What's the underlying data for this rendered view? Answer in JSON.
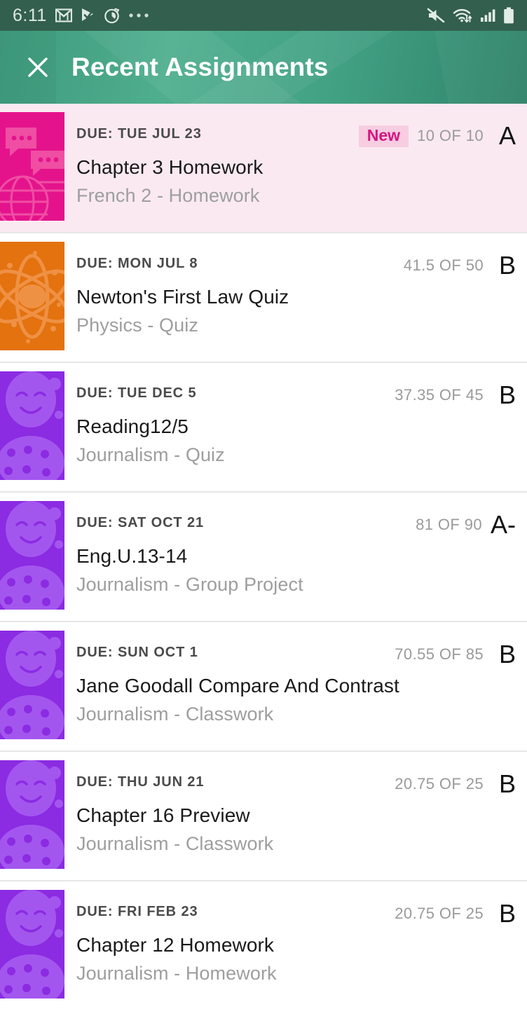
{
  "status_bar": {
    "time": "6:11",
    "left_icons": [
      "gmail-icon",
      "play-check-icon",
      "alarm-sync-icon",
      "overflow-dots-icon"
    ],
    "right_icons": [
      "volume-muted-icon",
      "wifi-icon",
      "cellular-signal-icon",
      "battery-icon"
    ],
    "background": "#335f4e"
  },
  "app_bar": {
    "title": "Recent Assignments",
    "close_label": "×",
    "background_start": "#4fae8e",
    "background_end": "#2f8369"
  },
  "assignments": [
    {
      "due": "DUE: TUE JUL 23",
      "title": "Chapter 3 Homework",
      "meta": "French 2 - Homework",
      "badge": "New",
      "score": "10 OF 10",
      "grade": "A",
      "highlight": true,
      "thumb_kind": "speech-globe",
      "thumb_color": "#e4138c",
      "thumb_accent": "#ef53a7"
    },
    {
      "due": "DUE: MON JUL 8",
      "title": "Newton's First Law Quiz",
      "meta": "Physics - Quiz",
      "badge": "",
      "score": "41.5 OF 50",
      "grade": "B",
      "highlight": false,
      "thumb_kind": "atom",
      "thumb_color": "#e3720f",
      "thumb_accent": "#ef914a"
    },
    {
      "due": "DUE: TUE DEC 5",
      "title": "Reading12/5",
      "meta": "Journalism - Quiz",
      "badge": "",
      "score": "37.35 OF 45",
      "grade": "B",
      "highlight": false,
      "thumb_kind": "masks",
      "thumb_color": "#8b2be2",
      "thumb_accent": "#a356ee"
    },
    {
      "due": "DUE: SAT OCT 21",
      "title": "Eng.U.13-14",
      "meta": "Journalism - Group Project",
      "badge": "",
      "score": "81 OF 90",
      "grade": "A-",
      "highlight": false,
      "thumb_kind": "masks",
      "thumb_color": "#8b2be2",
      "thumb_accent": "#a356ee"
    },
    {
      "due": "DUE: SUN OCT 1",
      "title": "Jane Goodall Compare And Contrast",
      "meta": "Journalism - Classwork",
      "badge": "",
      "score": "70.55 OF 85",
      "grade": "B",
      "highlight": false,
      "thumb_kind": "masks",
      "thumb_color": "#8b2be2",
      "thumb_accent": "#a356ee"
    },
    {
      "due": "DUE: THU JUN 21",
      "title": "Chapter 16 Preview",
      "meta": "Journalism - Classwork",
      "badge": "",
      "score": "20.75 OF 25",
      "grade": "B",
      "highlight": false,
      "thumb_kind": "masks",
      "thumb_color": "#8b2be2",
      "thumb_accent": "#a356ee"
    },
    {
      "due": "DUE: FRI FEB 23",
      "title": "Chapter 12 Homework",
      "meta": "Journalism - Homework",
      "badge": "",
      "score": "20.75 OF 25",
      "grade": "B",
      "highlight": false,
      "thumb_kind": "masks",
      "thumb_color": "#8b2be2",
      "thumb_accent": "#a356ee"
    }
  ]
}
